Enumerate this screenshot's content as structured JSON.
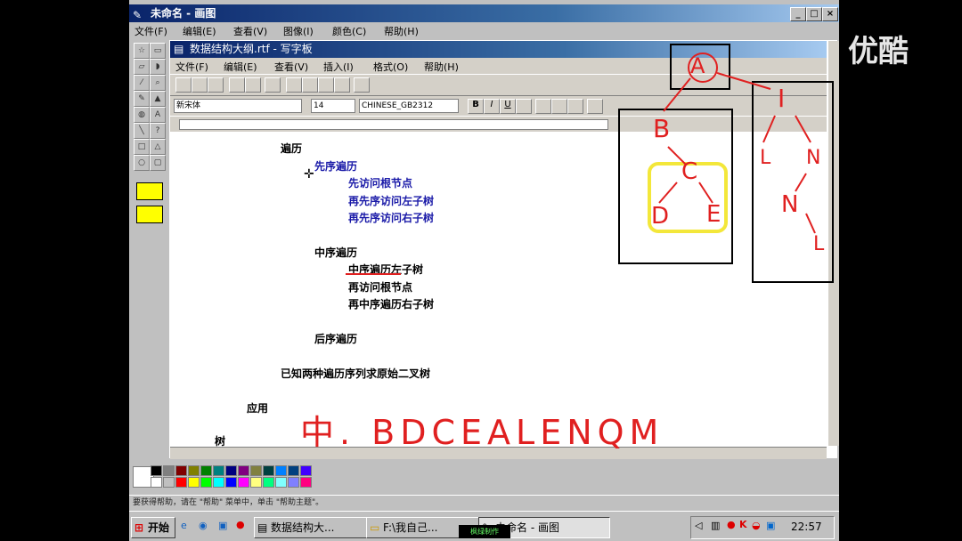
{
  "paint": {
    "title": "未命名 - 画图",
    "menu": [
      "文件(F)",
      "编辑(E)",
      "查看(V)",
      "图像(I)",
      "颜色(C)",
      "帮助(H)"
    ],
    "status": "要获得帮助，请在 \"帮助\" 菜单中，单击 \"帮助主题\"。"
  },
  "wordpad": {
    "title": "数据结构大纲.rtf - 写字板",
    "menu": [
      "文件(F)",
      "编辑(E)",
      "查看(V)",
      "插入(I)",
      "格式(O)",
      "帮助(H)"
    ],
    "font": "新宋体",
    "size": "14",
    "charset": "CHINESE_GB2312"
  },
  "document": {
    "lines": [
      {
        "text": "遍历",
        "color": "black"
      },
      {
        "text": "先序遍历",
        "color": "blue"
      },
      {
        "text": "先访问根节点",
        "color": "blue"
      },
      {
        "text": "再先序访问左子树",
        "color": "blue"
      },
      {
        "text": "再先序访问右子树",
        "color": "blue"
      },
      {
        "text": "中序遍历",
        "color": "black"
      },
      {
        "text": "中序遍历左子树",
        "color": "black"
      },
      {
        "text": "再访问根节点",
        "color": "black"
      },
      {
        "text": "再中序遍历右子树",
        "color": "black"
      },
      {
        "text": "后序遍历",
        "color": "black"
      },
      {
        "text": "已知两种遍历序列求原始二叉树",
        "color": "black"
      },
      {
        "text": "应用",
        "color": "black"
      },
      {
        "text": "树",
        "color": "black"
      }
    ]
  },
  "handwriting": {
    "sequence": "中. BDCEALENQM",
    "tree_nodes": [
      "A",
      "B",
      "C",
      "D",
      "E",
      "I",
      "L",
      "N",
      "N",
      "L"
    ]
  },
  "taskbar": {
    "start": "开始",
    "tasks": [
      "数据结构大...",
      "F:\\我自己...",
      "未命名 - 画图"
    ],
    "clock": "22:57",
    "overlay": "枫绿制作"
  },
  "brand": "优酷",
  "colors": {
    "ink": "#e02020",
    "highlight": "#f3e73a",
    "title_blue": "#0a246a",
    "text_blue": "#1a1aa8"
  }
}
